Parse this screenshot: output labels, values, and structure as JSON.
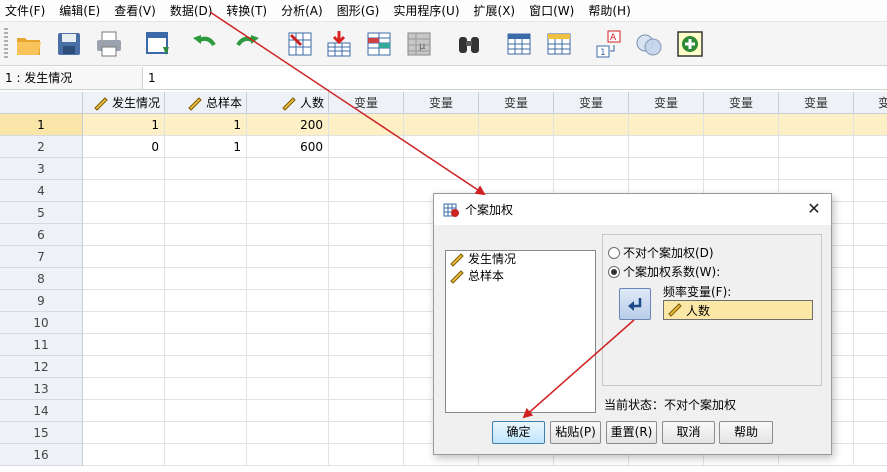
{
  "menu": [
    "文件(F)",
    "编辑(E)",
    "查看(V)",
    "数据(D)",
    "转换(T)",
    "分析(A)",
    "图形(G)",
    "实用程序(U)",
    "扩展(X)",
    "窗口(W)",
    "帮助(H)"
  ],
  "cellbar": {
    "ref": "1 : 发生情况",
    "value": "1"
  },
  "grid": {
    "columns": [
      "发生情况",
      "总样本",
      "人数",
      "变量",
      "变量",
      "变量",
      "变量",
      "变量",
      "变量",
      "变量",
      "变"
    ],
    "row_numbers": [
      "1",
      "2",
      "3",
      "4",
      "5",
      "6",
      "7",
      "8",
      "9",
      "10",
      "11",
      "12",
      "13",
      "14",
      "15",
      "16"
    ],
    "rows": [
      [
        "1",
        "1",
        "200"
      ],
      [
        "0",
        "1",
        "600"
      ]
    ]
  },
  "dialog": {
    "title": "个案加权",
    "close": "✕",
    "source_vars": [
      "发生情况",
      "总样本"
    ],
    "opt_none": "不对个案加权(D)",
    "opt_weight": "个案加权系数(W):",
    "freq_label": "频率变量(F):",
    "freq_value": "人数",
    "status": "当前状态：不对个案加权",
    "buttons": {
      "ok": "确定",
      "paste": "粘贴(P)",
      "reset": "重置(R)",
      "cancel": "取消",
      "help": "帮助"
    }
  },
  "colors": {
    "selected_row": "#fae6a8",
    "header_bg": "#eef2f7",
    "annotation": "#d02020"
  }
}
